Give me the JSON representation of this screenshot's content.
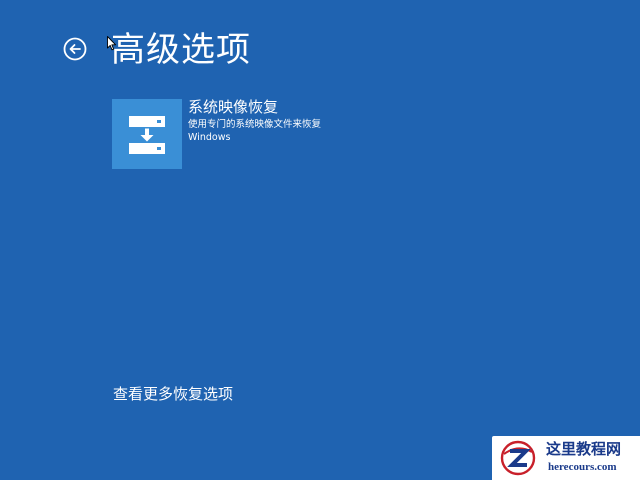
{
  "header": {
    "back_icon": "back-arrow-circle-icon",
    "title": "高级选项"
  },
  "options": [
    {
      "icon": "system-image-recovery-icon",
      "title": "系统映像恢复",
      "description_line1": "使用专门的系统映像文件来恢复",
      "description_line2": "Windows"
    }
  ],
  "footer": {
    "more_options_label": "查看更多恢复选项"
  },
  "watermark": {
    "name": "这里教程网",
    "domain": "herecours.com"
  },
  "colors": {
    "background": "#1f63b1",
    "tile_accent": "#3a8fd6",
    "text": "#ffffff"
  }
}
